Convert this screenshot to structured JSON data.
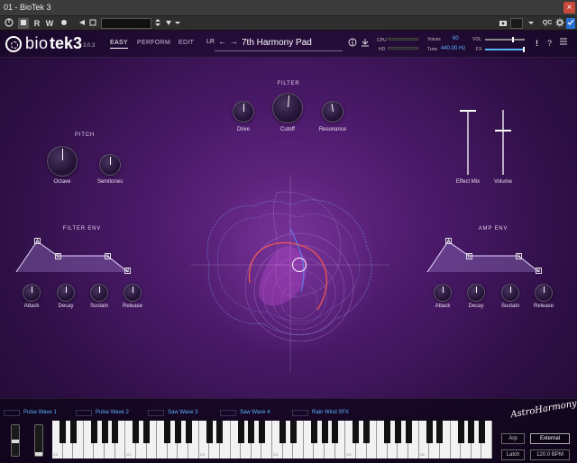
{
  "window": {
    "title": "01 - BioTek 3",
    "close_glyph": "×"
  },
  "host_toolbar": {
    "buttons": [
      "R",
      "W"
    ],
    "settings_label": "QC"
  },
  "plugin": {
    "logo": {
      "bio": "bio",
      "tek": "tek3",
      "version": "3.0.3"
    },
    "nav": {
      "easy": "EASY",
      "perform": "PERFORM",
      "edit": "EDIT"
    },
    "preset_name": "7th Harmony Pad",
    "preset_prefix": "LR",
    "meters": {
      "cpu_label": "CPU",
      "hd_label": "HD",
      "voices_label": "Voices",
      "voices_value": "60",
      "tune_label": "Tune",
      "tune_value": "440.00 Hz",
      "vol_label": "VOL",
      "fx_label": "FX"
    },
    "header_help": "?",
    "header_alert": "!",
    "sections": {
      "filter": "FILTER",
      "pitch": "PITCH",
      "filter_env": "FILTER ENV",
      "amp_env": "AMP ENV"
    },
    "knobs": {
      "drive": "Drive",
      "cutoff": "Cutoff",
      "resonance": "Resonance",
      "octave": "Octave",
      "semitones": "Semitones",
      "fe_attack": "Attack",
      "fe_decay": "Decay",
      "fe_sustain": "Sustain",
      "fe_release": "Release",
      "ae_attack": "Attack",
      "ae_decay": "Decay",
      "ae_sustain": "Sustain",
      "ae_release": "Release"
    },
    "faders": {
      "effect_mix": "Effect Mix",
      "volume": "Volume"
    },
    "env_points": [
      "A",
      "D",
      "S",
      "R"
    ],
    "wave_slots": [
      "Pulse Wave 1",
      "Pulse Wave 2",
      "Saw Wave 3",
      "Saw Wave 4",
      "Rain Wind SFX"
    ],
    "brand": "AstroHarmony",
    "perf_buttons": {
      "arp": "Arp",
      "external": "External",
      "latch": "Latch",
      "bpm": "120.0 BPM"
    },
    "octave_labels": [
      "C1",
      "C2",
      "C3",
      "C4",
      "C5",
      "C6"
    ]
  },
  "colors": {
    "accent": "#5ab4ff",
    "background": "#4b1a6a"
  }
}
